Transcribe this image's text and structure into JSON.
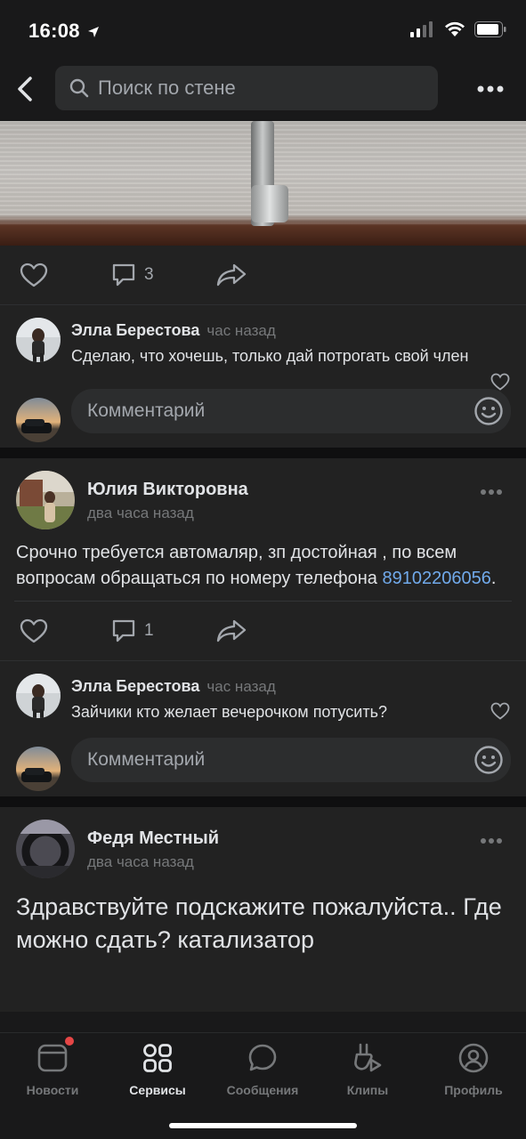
{
  "status": {
    "time": "16:08"
  },
  "search": {
    "placeholder": "Поиск по стене"
  },
  "post1": {
    "comments_count": "3",
    "comment": {
      "author": "Элла Берестова",
      "time": "час назад",
      "text": "Сделаю, что хочешь, только дай потрогать свой член"
    },
    "compose_placeholder": "Комментарий"
  },
  "post2": {
    "author": "Юлия Викторовна",
    "date": "два часа назад",
    "text": "Срочно требуется автомаляр, зп достойная , по всем вопросам обращаться по номеру телефона ",
    "phone": "89102206056",
    "text_end": ".",
    "comments_count": "1",
    "comment": {
      "author": "Элла Берестова",
      "time": "час назад",
      "text": "Зайчики кто желает вечерочком потусить?"
    },
    "compose_placeholder": "Комментарий"
  },
  "post3": {
    "author": "Федя Местный",
    "date": "два часа назад",
    "text": "Здравствуйте подскажите пожалуйста.. Где можно сдать? катализатор"
  },
  "nav": {
    "tabs": [
      {
        "label": "Новости",
        "icon": "news-icon",
        "badge": true
      },
      {
        "label": "Сервисы",
        "icon": "services-icon",
        "active": true
      },
      {
        "label": "Сообщения",
        "icon": "messages-icon"
      },
      {
        "label": "Клипы",
        "icon": "clips-icon"
      },
      {
        "label": "Профиль",
        "icon": "profile-icon"
      }
    ]
  },
  "colors": {
    "background": "#19191a",
    "card": "#222222",
    "link": "#71aaeb",
    "badge": "#e64646"
  }
}
